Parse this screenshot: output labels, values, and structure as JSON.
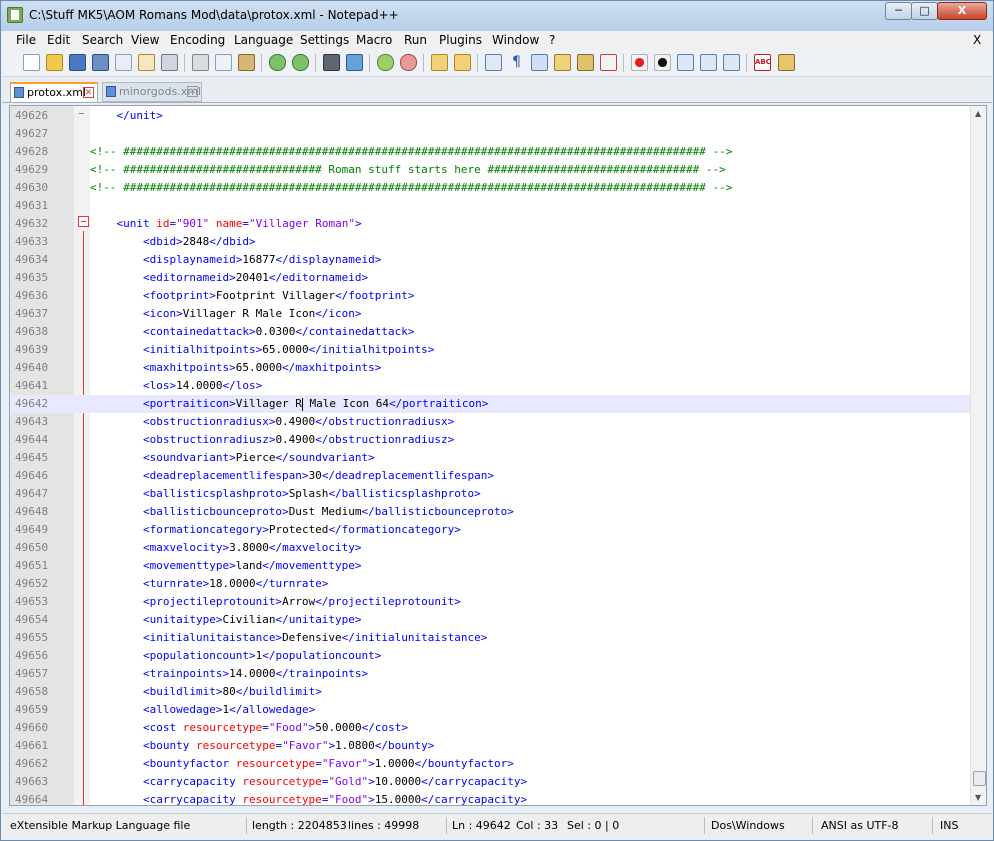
{
  "window": {
    "title": "C:\\Stuff MK5\\AOM Romans Mod\\data\\protox.xml - Notepad++",
    "min_label": "─",
    "max_label": "□",
    "close_label": "X"
  },
  "menu": {
    "items": [
      "File",
      "Edit",
      "Search",
      "View",
      "Encoding",
      "Language",
      "Settings",
      "Macro",
      "Run",
      "Plugins",
      "Window",
      "?"
    ],
    "close_doc": "X"
  },
  "tabs": [
    {
      "label": "protox.xml",
      "active": true
    },
    {
      "label": "minorgods.xml",
      "active": false
    }
  ],
  "editor": {
    "current_line": 49642,
    "lines": [
      {
        "n": "49626",
        "s": [
          [
            "x",
            "    "
          ],
          [
            "t",
            "</unit>"
          ]
        ]
      },
      {
        "n": "49627",
        "s": []
      },
      {
        "n": "49628",
        "s": [
          [
            "c",
            "<!-- ######################################################################################## -->"
          ]
        ]
      },
      {
        "n": "49629",
        "s": [
          [
            "c",
            "<!-- ############################## Roman stuff starts here ################################ -->"
          ]
        ]
      },
      {
        "n": "49630",
        "s": [
          [
            "c",
            "<!-- ######################################################################################## -->"
          ]
        ]
      },
      {
        "n": "49631",
        "s": []
      },
      {
        "n": "49632",
        "s": [
          [
            "x",
            "    "
          ],
          [
            "t",
            "<unit "
          ],
          [
            "a",
            "id"
          ],
          [
            "t",
            "="
          ],
          [
            "v",
            "\"901\""
          ],
          [
            "x",
            " "
          ],
          [
            "a",
            "name"
          ],
          [
            "t",
            "="
          ],
          [
            "v",
            "\"Villager Roman\""
          ],
          [
            "t",
            ">"
          ]
        ]
      },
      {
        "n": "49633",
        "s": [
          [
            "x",
            "        "
          ],
          [
            "t",
            "<dbid>"
          ],
          [
            "x",
            "2848"
          ],
          [
            "t",
            "</dbid>"
          ]
        ]
      },
      {
        "n": "49634",
        "s": [
          [
            "x",
            "        "
          ],
          [
            "t",
            "<displaynameid>"
          ],
          [
            "x",
            "16877"
          ],
          [
            "t",
            "</displaynameid>"
          ]
        ]
      },
      {
        "n": "49635",
        "s": [
          [
            "x",
            "        "
          ],
          [
            "t",
            "<editornameid>"
          ],
          [
            "x",
            "20401"
          ],
          [
            "t",
            "</editornameid>"
          ]
        ]
      },
      {
        "n": "49636",
        "s": [
          [
            "x",
            "        "
          ],
          [
            "t",
            "<footprint>"
          ],
          [
            "x",
            "Footprint Villager"
          ],
          [
            "t",
            "</footprint>"
          ]
        ]
      },
      {
        "n": "49637",
        "s": [
          [
            "x",
            "        "
          ],
          [
            "t",
            "<icon>"
          ],
          [
            "x",
            "Villager R Male Icon"
          ],
          [
            "t",
            "</icon>"
          ]
        ]
      },
      {
        "n": "49638",
        "s": [
          [
            "x",
            "        "
          ],
          [
            "t",
            "<containedattack>"
          ],
          [
            "x",
            "0.0300"
          ],
          [
            "t",
            "</containedattack>"
          ]
        ]
      },
      {
        "n": "49639",
        "s": [
          [
            "x",
            "        "
          ],
          [
            "t",
            "<initialhitpoints>"
          ],
          [
            "x",
            "65.0000"
          ],
          [
            "t",
            "</initialhitpoints>"
          ]
        ]
      },
      {
        "n": "49640",
        "s": [
          [
            "x",
            "        "
          ],
          [
            "t",
            "<maxhitpoints>"
          ],
          [
            "x",
            "65.0000"
          ],
          [
            "t",
            "</maxhitpoints>"
          ]
        ]
      },
      {
        "n": "49641",
        "s": [
          [
            "x",
            "        "
          ],
          [
            "t",
            "<los>"
          ],
          [
            "x",
            "14.0000"
          ],
          [
            "t",
            "</los>"
          ]
        ]
      },
      {
        "n": "49642",
        "s": [
          [
            "x",
            "        "
          ],
          [
            "t",
            "<portraiticon>"
          ],
          [
            "x",
            "Villager R"
          ],
          [
            "caret",
            ""
          ],
          [
            "x",
            " Male Icon 64"
          ],
          [
            "t",
            "</portraiticon>"
          ]
        ]
      },
      {
        "n": "49643",
        "s": [
          [
            "x",
            "        "
          ],
          [
            "t",
            "<obstructionradiusx>"
          ],
          [
            "x",
            "0.4900"
          ],
          [
            "t",
            "</obstructionradiusx>"
          ]
        ]
      },
      {
        "n": "49644",
        "s": [
          [
            "x",
            "        "
          ],
          [
            "t",
            "<obstructionradiusz>"
          ],
          [
            "x",
            "0.4900"
          ],
          [
            "t",
            "</obstructionradiusz>"
          ]
        ]
      },
      {
        "n": "49645",
        "s": [
          [
            "x",
            "        "
          ],
          [
            "t",
            "<soundvariant>"
          ],
          [
            "x",
            "Pierce"
          ],
          [
            "t",
            "</soundvariant>"
          ]
        ]
      },
      {
        "n": "49646",
        "s": [
          [
            "x",
            "        "
          ],
          [
            "t",
            "<deadreplacementlifespan>"
          ],
          [
            "x",
            "30"
          ],
          [
            "t",
            "</deadreplacementlifespan>"
          ]
        ]
      },
      {
        "n": "49647",
        "s": [
          [
            "x",
            "        "
          ],
          [
            "t",
            "<ballisticsplashproto>"
          ],
          [
            "x",
            "Splash"
          ],
          [
            "t",
            "</ballisticsplashproto>"
          ]
        ]
      },
      {
        "n": "49648",
        "s": [
          [
            "x",
            "        "
          ],
          [
            "t",
            "<ballisticbounceproto>"
          ],
          [
            "x",
            "Dust Medium"
          ],
          [
            "t",
            "</ballisticbounceproto>"
          ]
        ]
      },
      {
        "n": "49649",
        "s": [
          [
            "x",
            "        "
          ],
          [
            "t",
            "<formationcategory>"
          ],
          [
            "x",
            "Protected"
          ],
          [
            "t",
            "</formationcategory>"
          ]
        ]
      },
      {
        "n": "49650",
        "s": [
          [
            "x",
            "        "
          ],
          [
            "t",
            "<maxvelocity>"
          ],
          [
            "x",
            "3.8000"
          ],
          [
            "t",
            "</maxvelocity>"
          ]
        ]
      },
      {
        "n": "49651",
        "s": [
          [
            "x",
            "        "
          ],
          [
            "t",
            "<movementtype>"
          ],
          [
            "x",
            "land"
          ],
          [
            "t",
            "</movementtype>"
          ]
        ]
      },
      {
        "n": "49652",
        "s": [
          [
            "x",
            "        "
          ],
          [
            "t",
            "<turnrate>"
          ],
          [
            "x",
            "18.0000"
          ],
          [
            "t",
            "</turnrate>"
          ]
        ]
      },
      {
        "n": "49653",
        "s": [
          [
            "x",
            "        "
          ],
          [
            "t",
            "<projectileprotounit>"
          ],
          [
            "x",
            "Arrow"
          ],
          [
            "t",
            "</projectileprotounit>"
          ]
        ]
      },
      {
        "n": "49654",
        "s": [
          [
            "x",
            "        "
          ],
          [
            "t",
            "<unitaitype>"
          ],
          [
            "x",
            "Civilian"
          ],
          [
            "t",
            "</unitaitype>"
          ]
        ]
      },
      {
        "n": "49655",
        "s": [
          [
            "x",
            "        "
          ],
          [
            "t",
            "<initialunitaistance>"
          ],
          [
            "x",
            "Defensive"
          ],
          [
            "t",
            "</initialunitaistance>"
          ]
        ]
      },
      {
        "n": "49656",
        "s": [
          [
            "x",
            "        "
          ],
          [
            "t",
            "<populationcount>"
          ],
          [
            "x",
            "1"
          ],
          [
            "t",
            "</populationcount>"
          ]
        ]
      },
      {
        "n": "49657",
        "s": [
          [
            "x",
            "        "
          ],
          [
            "t",
            "<trainpoints>"
          ],
          [
            "x",
            "14.0000"
          ],
          [
            "t",
            "</trainpoints>"
          ]
        ]
      },
      {
        "n": "49658",
        "s": [
          [
            "x",
            "        "
          ],
          [
            "t",
            "<buildlimit>"
          ],
          [
            "x",
            "80"
          ],
          [
            "t",
            "</buildlimit>"
          ]
        ]
      },
      {
        "n": "49659",
        "s": [
          [
            "x",
            "        "
          ],
          [
            "t",
            "<allowedage>"
          ],
          [
            "x",
            "1"
          ],
          [
            "t",
            "</allowedage>"
          ]
        ]
      },
      {
        "n": "49660",
        "s": [
          [
            "x",
            "        "
          ],
          [
            "t",
            "<cost "
          ],
          [
            "a",
            "resourcetype"
          ],
          [
            "t",
            "="
          ],
          [
            "v",
            "\"Food\""
          ],
          [
            "t",
            ">"
          ],
          [
            "x",
            "50.0000"
          ],
          [
            "t",
            "</cost>"
          ]
        ]
      },
      {
        "n": "49661",
        "s": [
          [
            "x",
            "        "
          ],
          [
            "t",
            "<bounty "
          ],
          [
            "a",
            "resourcetype"
          ],
          [
            "t",
            "="
          ],
          [
            "v",
            "\"Favor\""
          ],
          [
            "t",
            ">"
          ],
          [
            "x",
            "1.0800"
          ],
          [
            "t",
            "</bounty>"
          ]
        ]
      },
      {
        "n": "49662",
        "s": [
          [
            "x",
            "        "
          ],
          [
            "t",
            "<bountyfactor "
          ],
          [
            "a",
            "resourcetype"
          ],
          [
            "t",
            "="
          ],
          [
            "v",
            "\"Favor\""
          ],
          [
            "t",
            ">"
          ],
          [
            "x",
            "1.0000"
          ],
          [
            "t",
            "</bountyfactor>"
          ]
        ]
      },
      {
        "n": "49663",
        "s": [
          [
            "x",
            "        "
          ],
          [
            "t",
            "<carrycapacity "
          ],
          [
            "a",
            "resourcetype"
          ],
          [
            "t",
            "="
          ],
          [
            "v",
            "\"Gold\""
          ],
          [
            "t",
            ">"
          ],
          [
            "x",
            "10.0000"
          ],
          [
            "t",
            "</carrycapacity>"
          ]
        ]
      },
      {
        "n": "49664",
        "s": [
          [
            "x",
            "        "
          ],
          [
            "t",
            "<carrycapacity "
          ],
          [
            "a",
            "resourcetype"
          ],
          [
            "t",
            "="
          ],
          [
            "v",
            "\"Food\""
          ],
          [
            "t",
            ">"
          ],
          [
            "x",
            "15.0000"
          ],
          [
            "t",
            "</carrycapacity>"
          ]
        ]
      }
    ]
  },
  "status": {
    "filetype": "eXtensible Markup Language file",
    "length": "length : 2204853",
    "lines": "lines : 49998",
    "ln": "Ln : 49642",
    "col": "Col : 33",
    "sel": "Sel : 0 | 0",
    "eol": "Dos\\Windows",
    "encoding": "ANSI as UTF-8",
    "mode": "INS"
  },
  "toolbar_icons": [
    "new-file-icon",
    "open-file-icon",
    "save-icon",
    "save-all-icon",
    "close-icon",
    "close-all-icon",
    "print-icon",
    "cut-icon",
    "copy-icon",
    "paste-icon",
    "undo-icon",
    "redo-icon",
    "find-icon",
    "replace-icon",
    "zoom-in-icon",
    "zoom-out-icon",
    "sync-v-icon",
    "sync-h-icon",
    "word-wrap-icon",
    "show-all-chars-icon",
    "indent-guide-icon",
    "user-lang-icon",
    "doc-map-icon",
    "function-list-icon",
    "record-macro-icon",
    "stop-macro-icon",
    "play-macro-icon",
    "run-macro-multiple-icon",
    "save-macro-icon",
    "spell-check-icon",
    "spell-check-options-icon"
  ]
}
